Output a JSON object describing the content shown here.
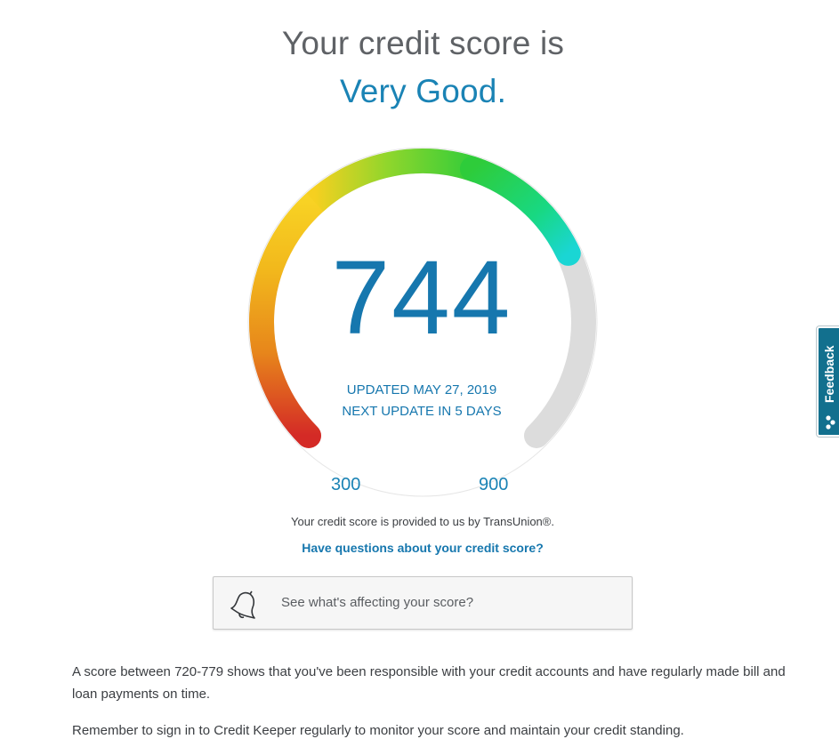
{
  "header": {
    "line1": "Your credit score is",
    "line2": "Very Good."
  },
  "gauge": {
    "score": "744",
    "score_value": 744,
    "min_label": "300",
    "max_label": "900",
    "min": 300,
    "max": 900,
    "updated": "UPDATED MAY 27, 2019",
    "next_update": "NEXT UPDATE IN 5 DAYS"
  },
  "provider_text": "Your credit score is provided to us by TransUnion®.",
  "questions_link": "Have questions about your credit score?",
  "affecting_box": {
    "icon": "bell-icon",
    "label": "See what's affecting your score?"
  },
  "paragraphs": [
    "A score between 720-779 shows that you've been responsible with your credit accounts and have regularly made bill and loan payments on time.",
    "Remember to sign in to Credit Keeper regularly to monitor your score and maintain your credit standing."
  ],
  "feedback_tab": {
    "label": "Feedback",
    "icon": "feedback-dots-icon"
  },
  "colors": {
    "accent": "#1677ae",
    "gauge_track": "#dcdcdc",
    "gauge_red": "#d42a26",
    "gauge_orange": "#e88a1a",
    "gauge_yellow": "#f6d020",
    "gauge_green": "#2ecc3a",
    "gauge_teal": "#20d6cc",
    "feedback_bg": "#12708e"
  }
}
